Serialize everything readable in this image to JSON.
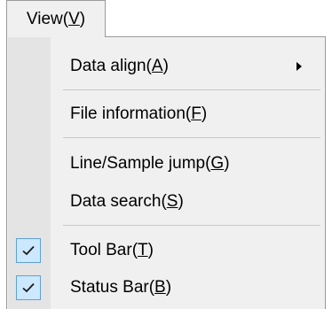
{
  "menubar": {
    "view": {
      "text": "View(",
      "mnemonic": "V",
      "close": ")"
    }
  },
  "menu": {
    "items": [
      {
        "text": "Data align(",
        "mnemonic": "A",
        "close": ")",
        "submenu": true,
        "checked": false
      },
      {
        "text": "File information(",
        "mnemonic": "F",
        "close": ")",
        "submenu": false,
        "checked": false
      },
      {
        "text": "Line/Sample jump(",
        "mnemonic": "G",
        "close": ")",
        "submenu": false,
        "checked": false
      },
      {
        "text": "Data search(",
        "mnemonic": "S",
        "close": ")",
        "submenu": false,
        "checked": false
      },
      {
        "text": "Tool Bar(",
        "mnemonic": "T",
        "close": ")",
        "submenu": false,
        "checked": true
      },
      {
        "text": "Status Bar(",
        "mnemonic": "B",
        "close": ")",
        "submenu": false,
        "checked": true
      }
    ]
  },
  "icons": {
    "submenu": "submenu-arrow-icon",
    "check": "checkmark-icon"
  },
  "colors": {
    "menu_bg": "#f0f0f0",
    "gutter_bg": "#e4e4e4",
    "check_bg": "#cce8ff",
    "check_border": "#5fa0d8"
  }
}
